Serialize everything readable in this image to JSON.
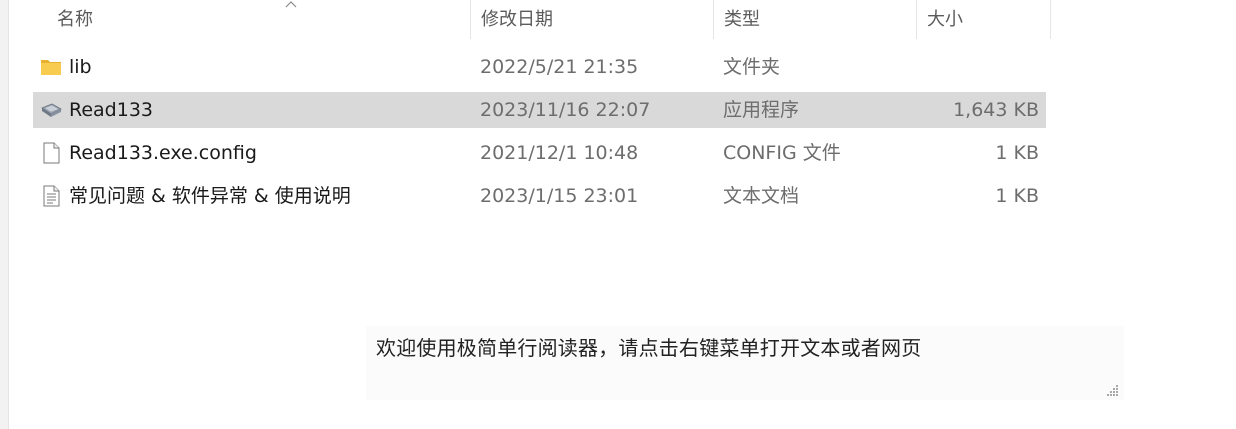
{
  "columns": {
    "name": "名称",
    "date_modified": "修改日期",
    "type": "类型",
    "size": "大小"
  },
  "files": [
    {
      "name": "lib",
      "date": "2022/5/21 21:35",
      "type": "文件夹",
      "size": "",
      "icon": "folder-icon",
      "selected": false
    },
    {
      "name": "Read133",
      "date": "2023/11/16 22:07",
      "type": "应用程序",
      "size": "1,643 KB",
      "icon": "application-icon",
      "selected": true
    },
    {
      "name": "Read133.exe.config",
      "date": "2021/12/1 10:48",
      "type": "CONFIG 文件",
      "size": "1 KB",
      "icon": "file-icon",
      "selected": false
    },
    {
      "name": "常见问题 & 软件异常 & 使用说明",
      "date": "2023/1/15 23:01",
      "type": "文本文档",
      "size": "1 KB",
      "icon": "text-document-icon",
      "selected": false
    }
  ],
  "status_bar": {
    "message": "欢迎使用极简单行阅读器，请点击右键菜单打开文本或者网页"
  },
  "colors": {
    "selected_row": "#d9d9d9",
    "folder": "#f4c343",
    "header_text": "#5b5b5b",
    "meta_text": "#6d6d6d"
  }
}
